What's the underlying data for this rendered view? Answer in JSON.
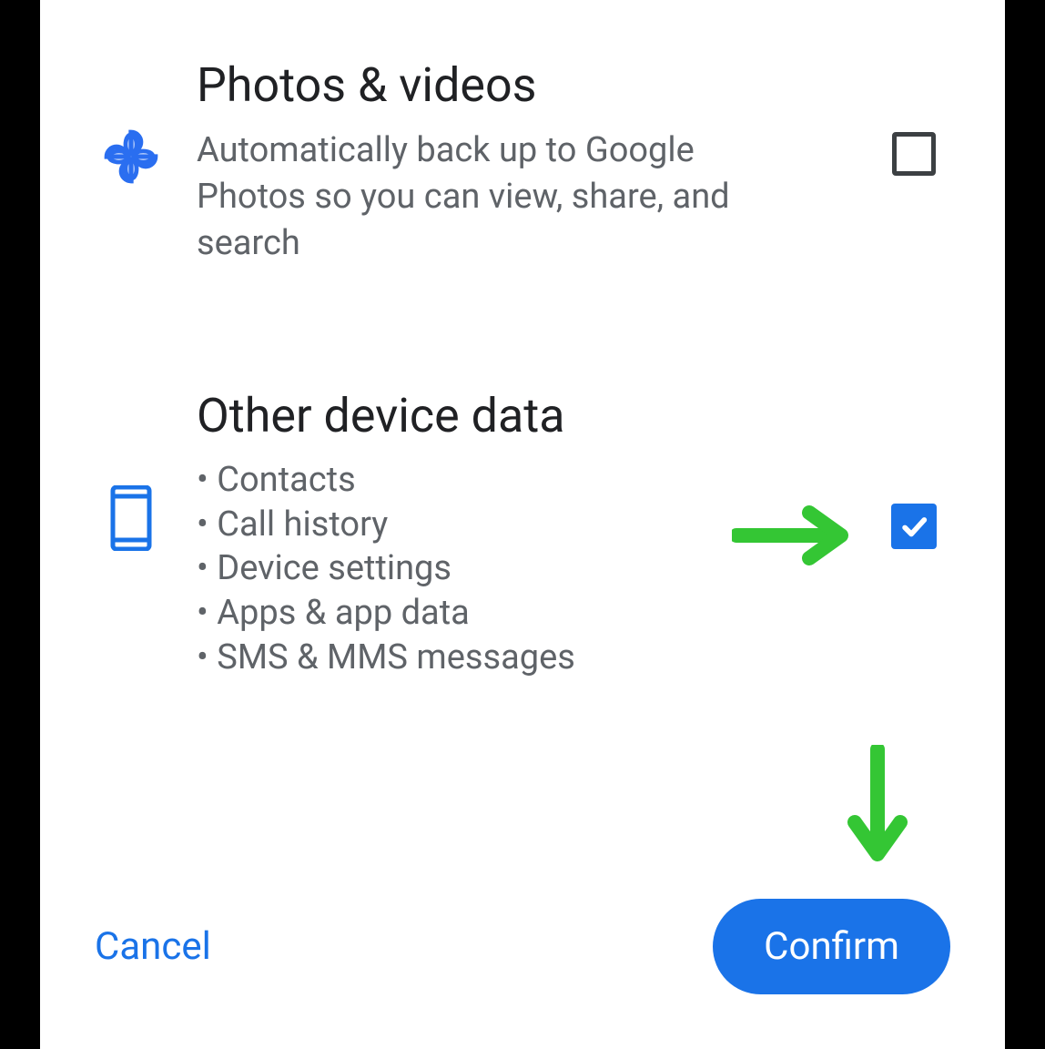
{
  "options": {
    "photos": {
      "title": "Photos & videos",
      "description": "Automatically back up to Google Photos so you can view, share, and search",
      "checked": false
    },
    "other": {
      "title": "Other device data",
      "bullets": [
        "Contacts",
        "Call history",
        "Device settings",
        "Apps & app data",
        "SMS & MMS messages"
      ],
      "checked": true
    }
  },
  "buttons": {
    "cancel": "Cancel",
    "confirm": "Confirm"
  },
  "colors": {
    "accent": "#1a73e8",
    "annotation": "#34c634"
  }
}
